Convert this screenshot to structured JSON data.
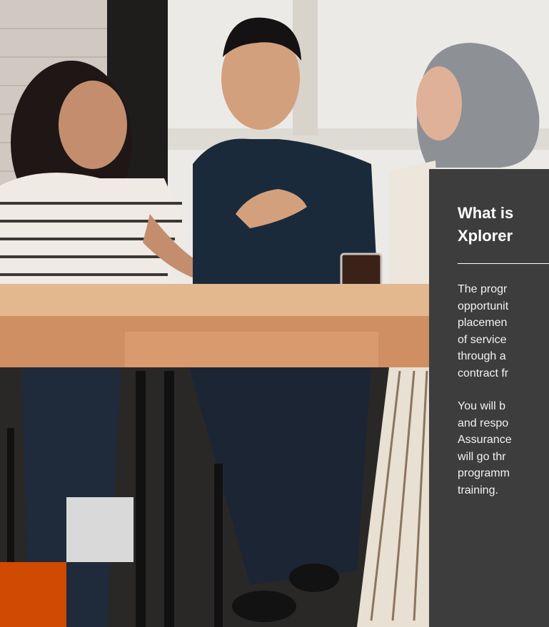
{
  "photo": {
    "description_icon": "people-photo-icon"
  },
  "card": {
    "title_lines": [
      "What is",
      "Xplorer"
    ],
    "paragraph1_lines": [
      "The progr",
      "opportunit",
      "placemen",
      "of service",
      "through a",
      "contract fr"
    ],
    "paragraph2_lines": [
      "You will b",
      "and respo",
      "Assurance",
      "will go thr",
      "programm",
      "training."
    ]
  },
  "colors": {
    "card_bg": "#3d3d3d",
    "accent_orange": "#d04a02",
    "accent_gray": "#d9d9d9"
  }
}
